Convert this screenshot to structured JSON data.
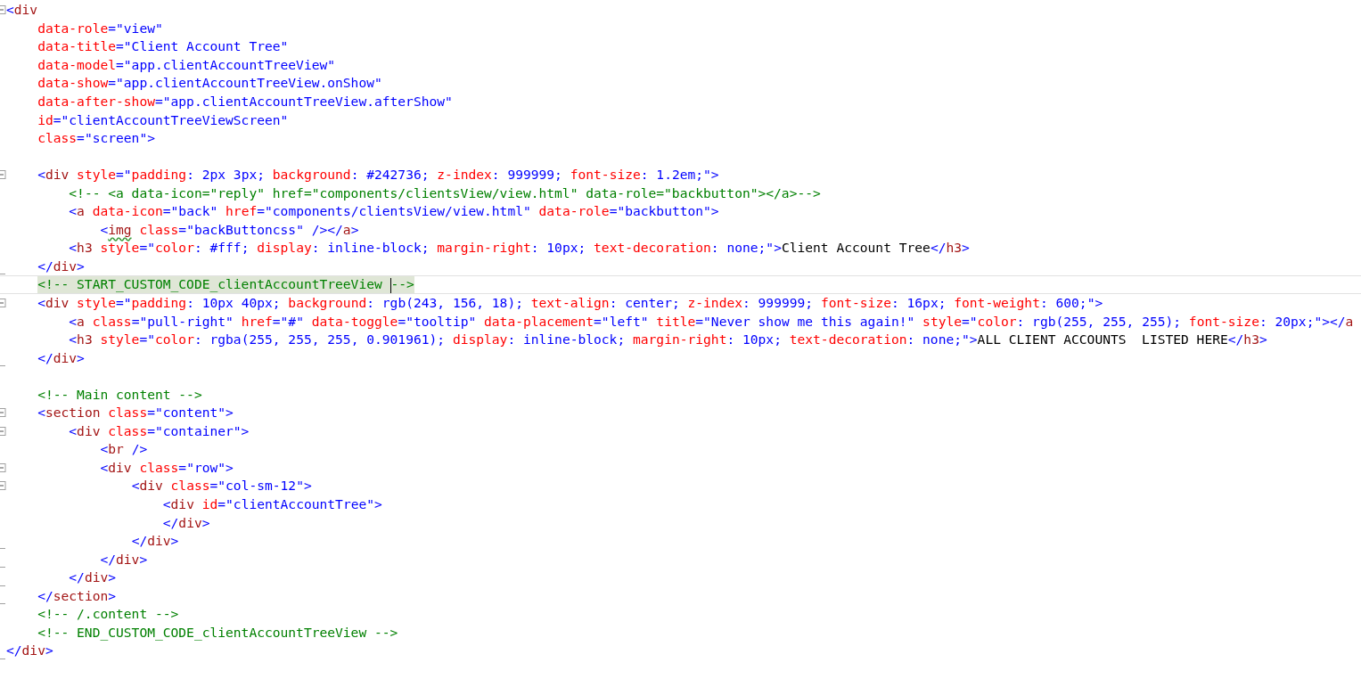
{
  "lines": [
    {
      "kind": "code",
      "collapsible": true,
      "block_end": false,
      "current": false,
      "tokens": [
        {
          "kind": "punct",
          "text": "<"
        },
        {
          "kind": "tag",
          "text": "div"
        }
      ],
      "children": [
        {
          "kind": "code",
          "collapsible": false,
          "block_end": false,
          "current": false,
          "tokens": [
            {
              "kind": "attr",
              "text": "data-role"
            },
            {
              "kind": "value",
              "text": "=\"view\""
            }
          ]
        },
        {
          "kind": "code",
          "collapsible": false,
          "block_end": false,
          "current": false,
          "tokens": [
            {
              "kind": "attr",
              "text": "data-title"
            },
            {
              "kind": "value",
              "text": "=\"Client Account Tree\""
            }
          ]
        },
        {
          "kind": "code",
          "collapsible": false,
          "block_end": false,
          "current": false,
          "tokens": [
            {
              "kind": "attr",
              "text": "data-model"
            },
            {
              "kind": "value",
              "text": "=\"app.clientAccountTreeView\""
            }
          ]
        },
        {
          "kind": "code",
          "collapsible": false,
          "block_end": false,
          "current": false,
          "tokens": [
            {
              "kind": "attr",
              "text": "data-show"
            },
            {
              "kind": "value",
              "text": "=\"app.clientAccountTreeView.onShow\""
            }
          ]
        },
        {
          "kind": "code",
          "collapsible": false,
          "block_end": false,
          "current": false,
          "tokens": [
            {
              "kind": "attr",
              "text": "data-after-show"
            },
            {
              "kind": "value",
              "text": "=\"app.clientAccountTreeView.afterShow\""
            }
          ]
        },
        {
          "kind": "code",
          "collapsible": false,
          "block_end": false,
          "current": false,
          "tokens": [
            {
              "kind": "attr",
              "text": "id"
            },
            {
              "kind": "value",
              "text": "=\"clientAccountTreeViewScreen\""
            }
          ]
        },
        {
          "kind": "code",
          "collapsible": false,
          "block_end": false,
          "current": false,
          "tokens": [
            {
              "kind": "attr",
              "text": "class"
            },
            {
              "kind": "value",
              "text": "=\"screen\">"
            }
          ]
        },
        {
          "kind": "blank",
          "collapsible": false,
          "block_end": false,
          "current": false
        },
        {
          "kind": "code",
          "collapsible": true,
          "block_end": false,
          "current": false,
          "tokens": [
            {
              "kind": "punct",
              "text": "<"
            },
            {
              "kind": "tag",
              "text": "div"
            },
            {
              "kind": "attr",
              "text": " style"
            },
            {
              "kind": "value",
              "text": "=\""
            },
            {
              "kind": "attr",
              "text": "padding"
            },
            {
              "kind": "value",
              "text": ": 2px 3px; "
            },
            {
              "kind": "attr",
              "text": "background"
            },
            {
              "kind": "value",
              "text": ": #242736; "
            },
            {
              "kind": "attr",
              "text": "z-index"
            },
            {
              "kind": "value",
              "text": ": 999999; "
            },
            {
              "kind": "attr",
              "text": "font-size"
            },
            {
              "kind": "value",
              "text": ": 1.2em;\">"
            }
          ],
          "children": [
            {
              "kind": "code",
              "collapsible": false,
              "block_end": false,
              "current": false,
              "tokens": [
                {
                  "kind": "comment",
                  "text": "<!-- <a data-icon=\"reply\" href=\"components/clientsView/view.html\" data-role=\"backbutton\"></a>-->"
                }
              ]
            },
            {
              "kind": "code",
              "collapsible": false,
              "block_end": false,
              "current": false,
              "tokens": [
                {
                  "kind": "punct",
                  "text": "<"
                },
                {
                  "kind": "tag",
                  "text": "a"
                },
                {
                  "kind": "attr",
                  "text": " data-icon"
                },
                {
                  "kind": "value",
                  "text": "=\"back\""
                },
                {
                  "kind": "attr",
                  "text": " href"
                },
                {
                  "kind": "value",
                  "text": "=\"components/clientsView/view.html\""
                },
                {
                  "kind": "attr",
                  "text": " data-role"
                },
                {
                  "kind": "value",
                  "text": "=\"backbutton\">"
                }
              ],
              "children": [
                {
                  "kind": "code",
                  "collapsible": false,
                  "block_end": false,
                  "current": false,
                  "tokens": [
                    {
                      "kind": "punct",
                      "text": "<"
                    },
                    {
                      "kind": "tag-warn",
                      "text": "img"
                    },
                    {
                      "kind": "attr",
                      "text": " class"
                    },
                    {
                      "kind": "value",
                      "text": "=\"backButtoncss\" />"
                    },
                    {
                      "kind": "punct",
                      "text": "</"
                    },
                    {
                      "kind": "tag",
                      "text": "a"
                    },
                    {
                      "kind": "punct",
                      "text": ">"
                    }
                  ]
                }
              ]
            },
            {
              "kind": "code",
              "collapsible": false,
              "block_end": false,
              "current": false,
              "tokens": [
                {
                  "kind": "punct",
                  "text": "<"
                },
                {
                  "kind": "tag",
                  "text": "h3"
                },
                {
                  "kind": "attr",
                  "text": " style"
                },
                {
                  "kind": "value",
                  "text": "=\""
                },
                {
                  "kind": "attr",
                  "text": "color"
                },
                {
                  "kind": "value",
                  "text": ": #fff; "
                },
                {
                  "kind": "attr",
                  "text": "display"
                },
                {
                  "kind": "value",
                  "text": ": inline-block; "
                },
                {
                  "kind": "attr",
                  "text": "margin-right"
                },
                {
                  "kind": "value",
                  "text": ": 10px; "
                },
                {
                  "kind": "attr",
                  "text": "text-decoration"
                },
                {
                  "kind": "value",
                  "text": ": none;\">"
                },
                {
                  "kind": "text",
                  "text": "Client Account Tree"
                },
                {
                  "kind": "punct",
                  "text": "</"
                },
                {
                  "kind": "tag",
                  "text": "h3"
                },
                {
                  "kind": "punct",
                  "text": ">"
                }
              ]
            }
          ]
        },
        {
          "kind": "code",
          "collapsible": false,
          "block_end": true,
          "current": false,
          "tokens": [
            {
              "kind": "punct",
              "text": "</"
            },
            {
              "kind": "tag",
              "text": "div"
            },
            {
              "kind": "punct",
              "text": ">"
            }
          ]
        },
        {
          "kind": "code",
          "collapsible": false,
          "block_end": false,
          "current": true,
          "tokens": [
            {
              "kind": "comment",
              "text": "<!-- START_CUSTOM_CODE_clientAccountTreeView "
            },
            {
              "kind": "cursor"
            },
            {
              "kind": "comment",
              "text": "-->"
            }
          ]
        },
        {
          "kind": "code",
          "collapsible": true,
          "block_end": false,
          "current": false,
          "tokens": [
            {
              "kind": "punct",
              "text": "<"
            },
            {
              "kind": "tag",
              "text": "div"
            },
            {
              "kind": "attr",
              "text": " style"
            },
            {
              "kind": "value",
              "text": "=\""
            },
            {
              "kind": "attr",
              "text": "padding"
            },
            {
              "kind": "value",
              "text": ": 10px 40px; "
            },
            {
              "kind": "attr",
              "text": "background"
            },
            {
              "kind": "value",
              "text": ": rgb(243, 156, 18); "
            },
            {
              "kind": "attr",
              "text": "text-align"
            },
            {
              "kind": "value",
              "text": ": center; "
            },
            {
              "kind": "attr",
              "text": "z-index"
            },
            {
              "kind": "value",
              "text": ": 999999; "
            },
            {
              "kind": "attr",
              "text": "font-size"
            },
            {
              "kind": "value",
              "text": ": 16px; "
            },
            {
              "kind": "attr",
              "text": "font-weight"
            },
            {
              "kind": "value",
              "text": ": 600;\">"
            }
          ],
          "children": [
            {
              "kind": "code",
              "collapsible": false,
              "block_end": false,
              "current": false,
              "tokens": [
                {
                  "kind": "punct",
                  "text": "<"
                },
                {
                  "kind": "tag",
                  "text": "a"
                },
                {
                  "kind": "attr",
                  "text": " class"
                },
                {
                  "kind": "value",
                  "text": "=\"pull-right\""
                },
                {
                  "kind": "attr",
                  "text": " href"
                },
                {
                  "kind": "value",
                  "text": "=\"#\""
                },
                {
                  "kind": "attr",
                  "text": " data-toggle"
                },
                {
                  "kind": "value",
                  "text": "=\"tooltip\""
                },
                {
                  "kind": "attr",
                  "text": " data-placement"
                },
                {
                  "kind": "value",
                  "text": "=\"left\""
                },
                {
                  "kind": "attr",
                  "text": " title"
                },
                {
                  "kind": "value",
                  "text": "=\"Never show me this again!\""
                },
                {
                  "kind": "attr",
                  "text": " style"
                },
                {
                  "kind": "value",
                  "text": "=\""
                },
                {
                  "kind": "attr",
                  "text": "color"
                },
                {
                  "kind": "value",
                  "text": ": rgb(255, 255, 255); "
                },
                {
                  "kind": "attr",
                  "text": "font-size"
                },
                {
                  "kind": "value",
                  "text": ": 20px;\">"
                },
                {
                  "kind": "punct",
                  "text": "</"
                },
                {
                  "kind": "tag",
                  "text": "a"
                }
              ]
            },
            {
              "kind": "code",
              "collapsible": false,
              "block_end": false,
              "current": false,
              "tokens": [
                {
                  "kind": "punct",
                  "text": "<"
                },
                {
                  "kind": "tag",
                  "text": "h3"
                },
                {
                  "kind": "attr",
                  "text": " style"
                },
                {
                  "kind": "value",
                  "text": "=\""
                },
                {
                  "kind": "attr",
                  "text": "color"
                },
                {
                  "kind": "value",
                  "text": ": rgba(255, 255, 255, 0.901961); "
                },
                {
                  "kind": "attr",
                  "text": "display"
                },
                {
                  "kind": "value",
                  "text": ": inline-block; "
                },
                {
                  "kind": "attr",
                  "text": "margin-right"
                },
                {
                  "kind": "value",
                  "text": ": 10px; "
                },
                {
                  "kind": "attr",
                  "text": "text-decoration"
                },
                {
                  "kind": "value",
                  "text": ": none;\">"
                },
                {
                  "kind": "text",
                  "text": "ALL CLIENT ACCOUNTS  LISTED HERE"
                },
                {
                  "kind": "punct",
                  "text": "</"
                },
                {
                  "kind": "tag",
                  "text": "h3"
                },
                {
                  "kind": "punct",
                  "text": ">"
                }
              ]
            }
          ]
        },
        {
          "kind": "code",
          "collapsible": false,
          "block_end": true,
          "current": false,
          "tokens": [
            {
              "kind": "punct",
              "text": "</"
            },
            {
              "kind": "tag",
              "text": "div"
            },
            {
              "kind": "punct",
              "text": ">"
            }
          ]
        },
        {
          "kind": "blank",
          "collapsible": false,
          "block_end": false,
          "current": false
        },
        {
          "kind": "code",
          "collapsible": false,
          "block_end": false,
          "current": false,
          "tokens": [
            {
              "kind": "comment",
              "text": "<!-- Main content -->"
            }
          ]
        },
        {
          "kind": "code",
          "collapsible": true,
          "block_end": false,
          "current": false,
          "tokens": [
            {
              "kind": "punct",
              "text": "<"
            },
            {
              "kind": "tag",
              "text": "section"
            },
            {
              "kind": "attr",
              "text": " class"
            },
            {
              "kind": "value",
              "text": "=\"content\">"
            }
          ],
          "children": [
            {
              "kind": "code",
              "collapsible": true,
              "block_end": false,
              "current": false,
              "tokens": [
                {
                  "kind": "punct",
                  "text": "<"
                },
                {
                  "kind": "tag",
                  "text": "div"
                },
                {
                  "kind": "attr",
                  "text": " class"
                },
                {
                  "kind": "value",
                  "text": "=\"container\">"
                }
              ],
              "children": [
                {
                  "kind": "code",
                  "collapsible": false,
                  "block_end": false,
                  "current": false,
                  "tokens": [
                    {
                      "kind": "punct",
                      "text": "<"
                    },
                    {
                      "kind": "tag",
                      "text": "br"
                    },
                    {
                      "kind": "value",
                      "text": " />"
                    }
                  ]
                },
                {
                  "kind": "code",
                  "collapsible": true,
                  "block_end": false,
                  "current": false,
                  "tokens": [
                    {
                      "kind": "punct",
                      "text": "<"
                    },
                    {
                      "kind": "tag",
                      "text": "div"
                    },
                    {
                      "kind": "attr",
                      "text": " class"
                    },
                    {
                      "kind": "value",
                      "text": "=\"row\">"
                    }
                  ],
                  "children": [
                    {
                      "kind": "code",
                      "collapsible": true,
                      "block_end": false,
                      "current": false,
                      "tokens": [
                        {
                          "kind": "punct",
                          "text": "<"
                        },
                        {
                          "kind": "tag",
                          "text": "div"
                        },
                        {
                          "kind": "attr",
                          "text": " class"
                        },
                        {
                          "kind": "value",
                          "text": "=\"col-sm-12\">"
                        }
                      ],
                      "children": [
                        {
                          "kind": "code",
                          "collapsible": false,
                          "block_end": false,
                          "current": false,
                          "tokens": [
                            {
                              "kind": "punct",
                              "text": "<"
                            },
                            {
                              "kind": "tag",
                              "text": "div"
                            },
                            {
                              "kind": "attr",
                              "text": " id"
                            },
                            {
                              "kind": "value",
                              "text": "=\"clientAccountTree\">"
                            }
                          ]
                        },
                        {
                          "kind": "code",
                          "collapsible": false,
                          "block_end": false,
                          "current": false,
                          "tokens": [
                            {
                              "kind": "punct",
                              "text": "</"
                            },
                            {
                              "kind": "tag",
                              "text": "div"
                            },
                            {
                              "kind": "punct",
                              "text": ">"
                            }
                          ]
                        }
                      ]
                    },
                    {
                      "kind": "code",
                      "collapsible": false,
                      "block_end": true,
                      "current": false,
                      "tokens": [
                        {
                          "kind": "punct",
                          "text": "</"
                        },
                        {
                          "kind": "tag",
                          "text": "div"
                        },
                        {
                          "kind": "punct",
                          "text": ">"
                        }
                      ]
                    }
                  ]
                },
                {
                  "kind": "code",
                  "collapsible": false,
                  "block_end": true,
                  "current": false,
                  "tokens": [
                    {
                      "kind": "punct",
                      "text": "</"
                    },
                    {
                      "kind": "tag",
                      "text": "div"
                    },
                    {
                      "kind": "punct",
                      "text": ">"
                    }
                  ]
                }
              ]
            },
            {
              "kind": "code",
              "collapsible": false,
              "block_end": true,
              "current": false,
              "tokens": [
                {
                  "kind": "punct",
                  "text": "</"
                },
                {
                  "kind": "tag",
                  "text": "div"
                },
                {
                  "kind": "punct",
                  "text": ">"
                }
              ]
            }
          ]
        },
        {
          "kind": "code",
          "collapsible": false,
          "block_end": true,
          "current": false,
          "tokens": [
            {
              "kind": "punct",
              "text": "</"
            },
            {
              "kind": "tag",
              "text": "section"
            },
            {
              "kind": "punct",
              "text": ">"
            }
          ]
        },
        {
          "kind": "code",
          "collapsible": false,
          "block_end": false,
          "current": false,
          "tokens": [
            {
              "kind": "comment",
              "text": "<!-- /.content -->"
            }
          ]
        },
        {
          "kind": "code",
          "collapsible": false,
          "block_end": false,
          "current": false,
          "tokens": [
            {
              "kind": "comment",
              "text": "<!-- END_CUSTOM_CODE_clientAccountTreeView -->"
            }
          ]
        }
      ]
    },
    {
      "kind": "code",
      "collapsible": false,
      "block_end": true,
      "current": false,
      "tokens": [
        {
          "kind": "punct",
          "text": "</"
        },
        {
          "kind": "tag",
          "text": "div"
        },
        {
          "kind": "punct",
          "text": ">"
        }
      ]
    }
  ]
}
